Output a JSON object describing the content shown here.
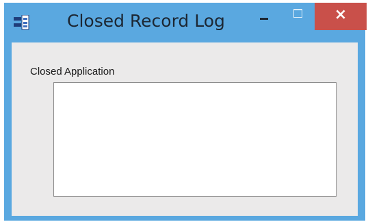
{
  "window": {
    "title": "Closed Record Log",
    "app_icon": "app-window-icon",
    "controls": {
      "minimize_icon": "minimize-icon",
      "maximize_icon": "maximize-icon",
      "close_icon": "close-icon",
      "close_glyph": "×"
    },
    "colors": {
      "titlebar": "#5aa8e0",
      "close_button": "#c9504a",
      "client_background": "#ebeaea"
    }
  },
  "content": {
    "listbox_label": "Closed Application",
    "listbox_items": []
  }
}
